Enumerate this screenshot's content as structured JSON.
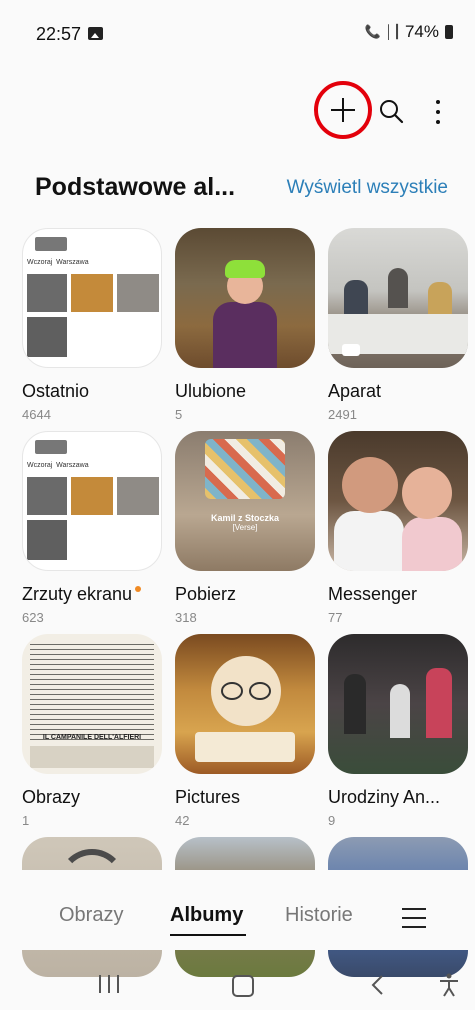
{
  "status_bar": {
    "time": "22:57",
    "battery": "74%",
    "icons": [
      "gallery-notification-icon",
      "wifi-calling-icon",
      "wifi-icon",
      "signal-icon",
      "battery-icon"
    ]
  },
  "toolbar": {
    "add_icon": "plus-icon",
    "search_icon": "search-icon",
    "more_icon": "more-vertical-icon",
    "highlight_color": "#e3000b"
  },
  "section": {
    "title": "Podstawowe al...",
    "view_all": "Wyświetl wszystkie"
  },
  "albums": [
    {
      "name": "Ostatnio",
      "count": "4644"
    },
    {
      "name": "Ulubione",
      "count": "5"
    },
    {
      "name": "Aparat",
      "count": "2491"
    },
    {
      "name": "Zrzuty ekranu",
      "count": "623"
    },
    {
      "name": "Pobierz",
      "count": "318"
    },
    {
      "name": "Messenger",
      "count": "77"
    },
    {
      "name": "Obrazy",
      "count": "1"
    },
    {
      "name": "Pictures",
      "count": "42"
    },
    {
      "name": "Urodziny An...",
      "count": "9"
    }
  ],
  "thumb_text": {
    "tab_a": "Wczoraj",
    "tab_b": "Warszawa",
    "pobierz_title": "Kamil z Stoczka",
    "pobierz_sub": "[Verse]",
    "obrazy_heading": "IL CAMPANILE DELL'ALFIERI"
  },
  "tabs": [
    {
      "label": "Obrazy",
      "active": false
    },
    {
      "label": "Albumy",
      "active": true
    },
    {
      "label": "Historie",
      "active": false
    }
  ],
  "nav": {
    "recents_icon": "recents-icon",
    "home_icon": "home-icon",
    "back_icon": "back-icon",
    "accessibility_icon": "accessibility-icon"
  },
  "colors": {
    "accent_link": "#2c7fb8",
    "new_dot": "#f08a24",
    "background": "#fafafa"
  }
}
